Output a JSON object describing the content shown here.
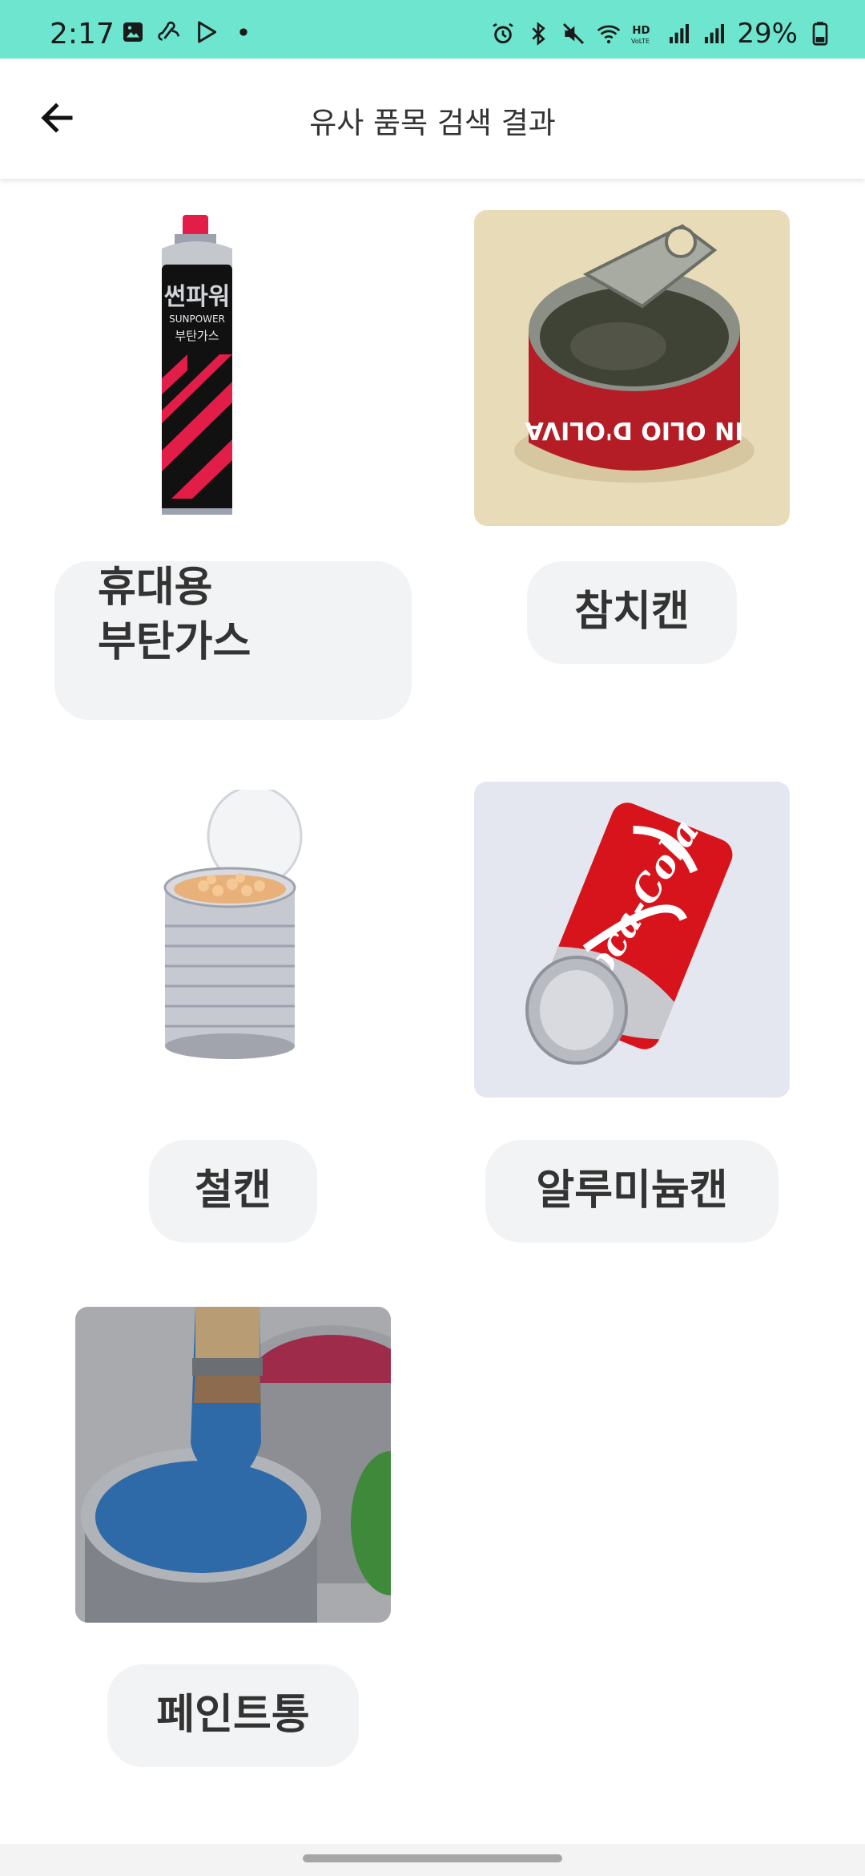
{
  "status_bar": {
    "time": "2:17",
    "battery": "29%",
    "icons_left": [
      "image-icon",
      "link-icon",
      "play-icon",
      "dot-icon"
    ],
    "icons_right": [
      "alarm-icon",
      "bluetooth-icon",
      "mute-icon",
      "wifi-icon",
      "hd-voice-icon",
      "signal-icon",
      "signal-r-icon",
      "battery-icon"
    ]
  },
  "app_bar": {
    "title": "유사 품목 검색 결과",
    "back_icon": "arrow-left-icon"
  },
  "items": [
    {
      "label_line1": "휴대용",
      "label_line2": "부탄가스"
    },
    {
      "label": "참치캔"
    },
    {
      "label": "철캔"
    },
    {
      "label": "알루미늄캔"
    },
    {
      "label": "페인트통"
    }
  ],
  "colors": {
    "status_bar_bg": "#6ee5cf",
    "chip_bg": "#f1f3f4",
    "text": "#333333"
  }
}
